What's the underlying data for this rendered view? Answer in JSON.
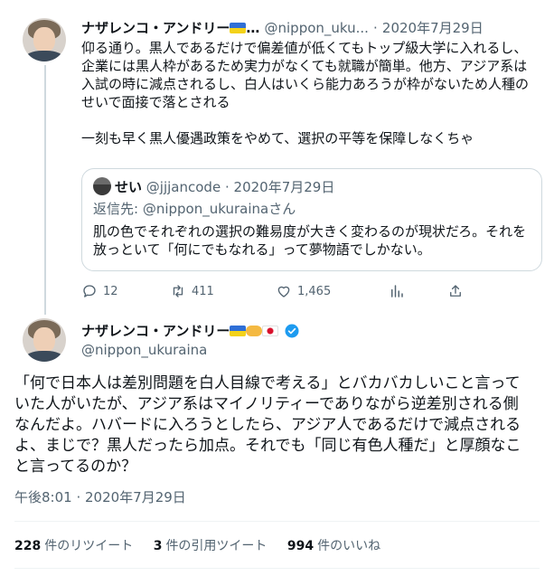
{
  "reply_tweet": {
    "author_name": "ナザレンコ・アンドリー",
    "name_suffix": "…",
    "handle": "@nippon_uku...",
    "separator": "·",
    "date": "2020年7月29日",
    "text_lines": [
      "仰る通り。黒人であるだけで偏差値が低くてもトップ級大学に入れるし、",
      "企業には黒人枠があるため実力がなくても就職が簡単。他方、アジア系は",
      "入試の時に減点されるし、白人はいくら能力あろうが枠がないため人種の",
      "せいで面接で落とされる",
      "",
      "一刻も早く黒人優遇政策をやめて、選択の平等を保障しなくちゃ"
    ],
    "quote": {
      "author_name": "せい",
      "handle": "@jjjancode",
      "separator": "·",
      "date": "2020年7月29日",
      "reply_prefix": "返信先: ",
      "reply_handle": "@nippon_ukurainaさん",
      "text_lines": [
        "肌の色でそれぞれの選択の難易度が大きく変わるのが現状だろ。それを",
        "放っといて「何にでもなれる」って夢物語でしかない。"
      ]
    },
    "actions": {
      "reply_count": "12",
      "retweet_count": "411",
      "like_count": "1,465"
    },
    "icons": [
      "reply-icon",
      "retweet-icon",
      "like-icon",
      "analytics-icon",
      "share-icon"
    ]
  },
  "main_tweet": {
    "author_name": "ナザレンコ・アンドリー",
    "handle": "@nippon_ukuraina",
    "text_lines": [
      "「何で日本人は差別問題を白人目線で考える」とバカバカしいこと言って",
      "いた人がいたが、アジア系はマイノリティーでありながら逆差別される側",
      "なんだよ。ハバードに入ろうとしたら、アジア人であるだけで減点される",
      "よ、まじで？黒人だったら加点。それでも「同じ有色人種だ」と厚顔なこ",
      "と言ってるのか？"
    ],
    "time": "午後8:01 · 2020年7月29日",
    "stats": {
      "retweets_value": "228",
      "retweets_label": "件のリツイート",
      "quotes_value": "3",
      "quotes_label": "件の引用ツイート",
      "likes_value": "994",
      "likes_label": "件のいいね"
    }
  },
  "colors": {
    "text": "#0f1419",
    "secondary": "#536471",
    "border": "#cfd9de",
    "verified": "#1d9bf0"
  }
}
